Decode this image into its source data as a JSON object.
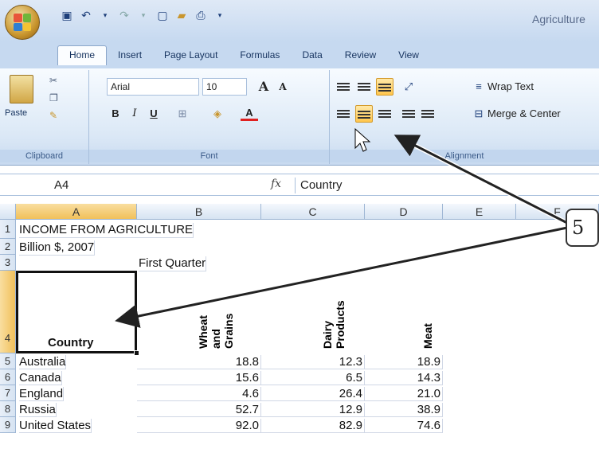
{
  "window": {
    "app_title": "Agriculture"
  },
  "office_button": {
    "colors": [
      "#e8563a",
      "#6fb63a",
      "#2f7fd4",
      "#f3c332"
    ]
  },
  "ribbon": {
    "tabs": [
      "Home",
      "Insert",
      "Page Layout",
      "Formulas",
      "Data",
      "Review",
      "View"
    ],
    "active_tab": "Home",
    "clipboard": {
      "paste_label": "Paste",
      "group_label": "Clipboard"
    },
    "font": {
      "font_name": "Arial",
      "font_size": "10",
      "grow_label": "A",
      "shrink_label": "A",
      "bold": "B",
      "italic": "I",
      "underline": "U",
      "font_color_label": "A",
      "group_label": "Font"
    },
    "alignment": {
      "wrap_text": "Wrap Text",
      "merge_center": "Merge & Center",
      "group_label": "Alignment"
    }
  },
  "formula_bar": {
    "name_box": "A4",
    "fx": "fx",
    "value": "Country"
  },
  "columns": [
    "A",
    "B",
    "C",
    "D",
    "E",
    "F"
  ],
  "rows": [
    "1",
    "2",
    "3",
    "4",
    "5",
    "6",
    "7",
    "8",
    "9"
  ],
  "cells": {
    "a1": "INCOME FROM AGRICULTURE",
    "a2": "Billion $, 2007",
    "b3": "First Quarter",
    "a4": "Country",
    "b4": [
      "Wheat",
      "and",
      "Grains"
    ],
    "c4": [
      "Dairy",
      "Products"
    ],
    "d4": "Meat"
  },
  "table": [
    {
      "country": "Australia",
      "wheat": "18.8",
      "dairy": "12.3",
      "meat": "18.9"
    },
    {
      "country": "Canada",
      "wheat": "15.6",
      "dairy": "6.5",
      "meat": "14.3"
    },
    {
      "country": "England",
      "wheat": "4.6",
      "dairy": "26.4",
      "meat": "21.0"
    },
    {
      "country": "Russia",
      "wheat": "52.7",
      "dairy": "12.9",
      "meat": "38.9"
    },
    {
      "country": "United States",
      "wheat": "92.0",
      "dairy": "82.9",
      "meat": "74.6"
    }
  ],
  "callout": {
    "number": "5"
  }
}
